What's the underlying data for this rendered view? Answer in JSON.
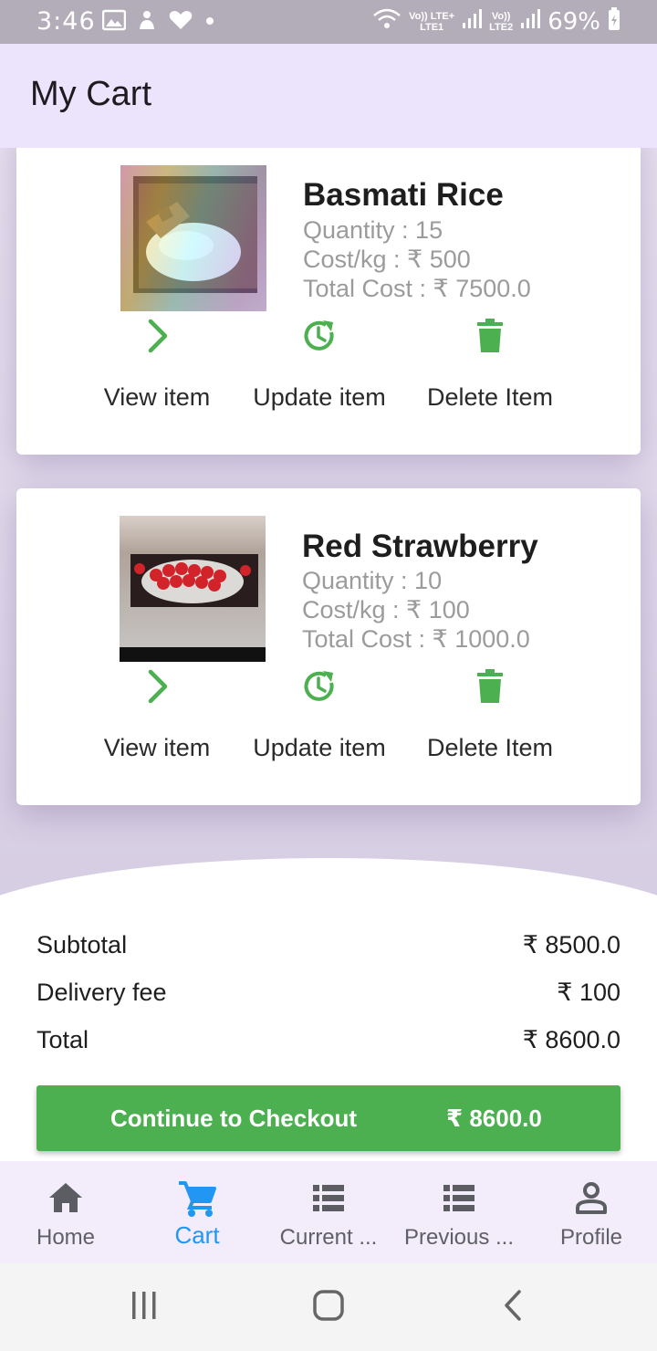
{
  "status_bar": {
    "time": "3:46",
    "sim1_top": "Vo)) LTE+",
    "sim1_bottom": "LTE1",
    "sim2_top": "Vo))",
    "sim2_bottom": "LTE2",
    "battery": "69%"
  },
  "app_bar": {
    "title": "My Cart"
  },
  "cart_items": [
    {
      "name": "Basmati Rice",
      "quantity": "Quantity : 15",
      "cost_per_kg": "Cost/kg : ₹ 500",
      "total_cost": "Total Cost : ₹ 7500.0",
      "view_label": "View item",
      "update_label": "Update item",
      "delete_label": "Delete Item"
    },
    {
      "name": "Red Strawberry",
      "quantity": "Quantity : 10",
      "cost_per_kg": "Cost/kg : ₹ 100",
      "total_cost": "Total Cost : ₹ 1000.0",
      "view_label": "View item",
      "update_label": "Update item",
      "delete_label": "Delete Item"
    }
  ],
  "summary": {
    "subtotal_label": "Subtotal",
    "subtotal_value": "₹ 8500.0",
    "delivery_label": "Delivery fee",
    "delivery_value": "₹ 100",
    "total_label": "Total",
    "total_value": "₹ 8600.0"
  },
  "checkout": {
    "label": "Continue to Checkout",
    "amount": "₹ 8600.0"
  },
  "bottom_nav": [
    {
      "label": "Home",
      "icon": "home-icon"
    },
    {
      "label": "Cart",
      "icon": "cart-icon",
      "active": true
    },
    {
      "label": "Current ...",
      "icon": "list-icon"
    },
    {
      "label": "Previous ...",
      "icon": "list-icon"
    },
    {
      "label": "Profile",
      "icon": "person-icon"
    }
  ],
  "colors": {
    "accent_green": "#4caf50",
    "active_blue": "#2196f3",
    "app_bar_bg": "#ece4fc",
    "nav_bg": "#f2ecfb"
  }
}
